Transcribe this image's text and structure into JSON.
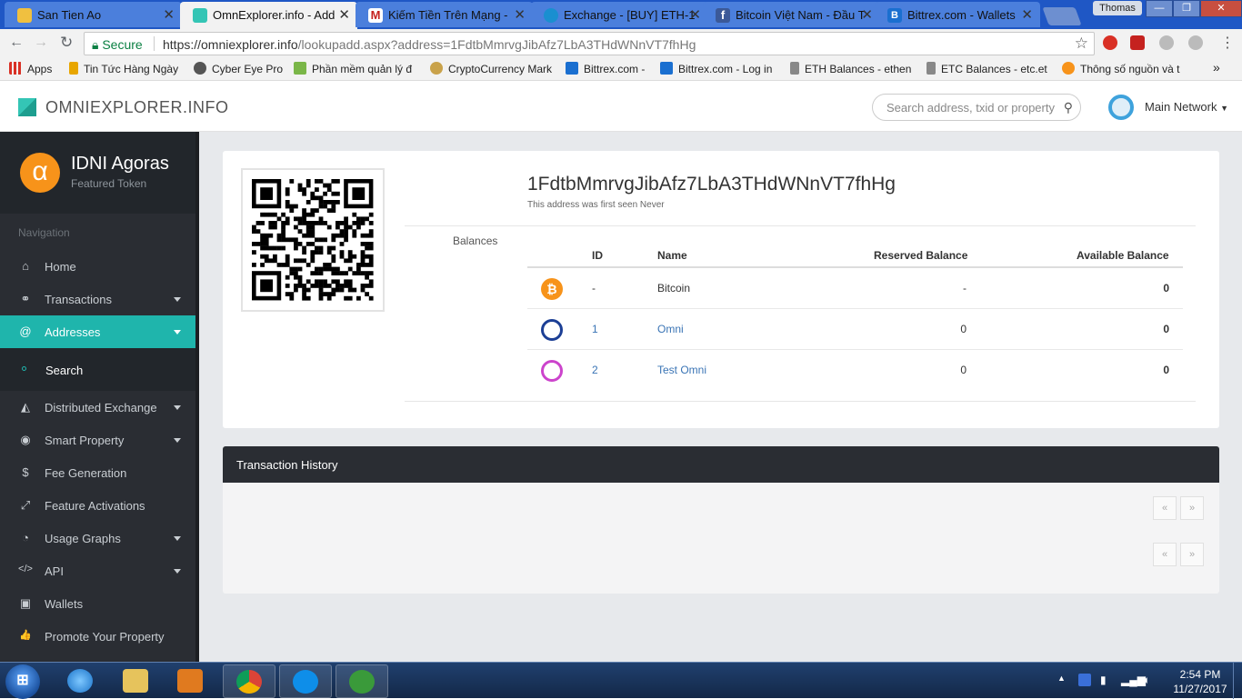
{
  "browser": {
    "tabs": [
      {
        "label": "San Tien Ao",
        "active": false
      },
      {
        "label": "OmnExplorer.info - Add",
        "active": true
      },
      {
        "label": "Kiếm Tiền Trên Mạng - ",
        "active": false
      },
      {
        "label": "Exchange - [BUY] ETH-1",
        "active": false
      },
      {
        "label": "Bitcoin Việt Nam - Đầu T",
        "active": false
      },
      {
        "label": "Bittrex.com - Wallets",
        "active": false
      }
    ],
    "user": "Thomas",
    "secure_label": "Secure",
    "url_host": "https://omniexplorer.info",
    "url_path": "/lookupadd.aspx?address=1FdtbMmrvgJibAfz7LbA3THdWNnVT7fhHg",
    "bookmarks": [
      {
        "label": "Apps"
      },
      {
        "label": "Tin Tức Hàng Ngày"
      },
      {
        "label": "Cyber Eye Pro"
      },
      {
        "label": "Phần mềm quản lý đ"
      },
      {
        "label": "CryptoCurrency Mark"
      },
      {
        "label": "Bittrex.com -"
      },
      {
        "label": "Bittrex.com - Log in"
      },
      {
        "label": "ETH Balances - ethen"
      },
      {
        "label": "ETC Balances - etc.et"
      },
      {
        "label": "Thông số nguồn và t"
      }
    ],
    "more_bookmarks": "»"
  },
  "header": {
    "brand": "OMNIEXPLORER.INFO",
    "search_placeholder": "Search address, txid or property",
    "network": "Main Network"
  },
  "sidebar": {
    "featured_name": "IDNI Agoras",
    "featured_sub": "Featured Token",
    "featured_symbol": "α",
    "nav_heading": "Navigation",
    "items": [
      {
        "label": "Home",
        "icon": "home-icon",
        "glyph": "⌂"
      },
      {
        "label": "Transactions",
        "icon": "link-icon",
        "glyph": "⚭"
      },
      {
        "label": "Addresses",
        "icon": "at-icon",
        "glyph": "@"
      },
      {
        "label": "Search",
        "icon": "dot-icon",
        "glyph": ""
      },
      {
        "label": "Distributed Exchange",
        "icon": "area-chart-icon",
        "glyph": "◭"
      },
      {
        "label": "Smart Property",
        "icon": "target-icon",
        "glyph": "◉"
      },
      {
        "label": "Fee Generation",
        "icon": "dollar-icon",
        "glyph": "$"
      },
      {
        "label": "Feature Activations",
        "icon": "expand-icon",
        "glyph": "⤢"
      },
      {
        "label": "Usage Graphs",
        "icon": "pie-chart-icon",
        "glyph": "◔"
      },
      {
        "label": "API",
        "icon": "code-icon",
        "glyph": "</>"
      },
      {
        "label": "Wallets",
        "icon": "wallet-icon",
        "glyph": "▣"
      },
      {
        "label": "Promote Your Property",
        "icon": "thumbs-up-icon",
        "glyph": "👍"
      }
    ]
  },
  "address": {
    "value": "1FdtbMmrvgJibAfz7LbA3THdWNnVT7fhHg",
    "first_seen": "This address was first seen Never",
    "balances_label": "Balances",
    "columns": [
      "ID",
      "Name",
      "Reserved Balance",
      "Available Balance"
    ],
    "rows": [
      {
        "icon": "bitcoin-icon",
        "id": "-",
        "name": "Bitcoin",
        "reserved": "-",
        "available": "0",
        "color": "#f7931a"
      },
      {
        "icon": "omni-icon",
        "id": "1",
        "name": "Omni",
        "reserved": "0",
        "available": "0",
        "color": "#1c3f95"
      },
      {
        "icon": "test-omni-icon",
        "id": "2",
        "name": "Test Omni",
        "reserved": "0",
        "available": "0",
        "color": "#cc44cc"
      }
    ]
  },
  "transactions": {
    "title": "Transaction History",
    "prev": "«",
    "next": "»"
  },
  "taskbar": {
    "time": "2:54 PM",
    "date": "11/27/2017"
  }
}
